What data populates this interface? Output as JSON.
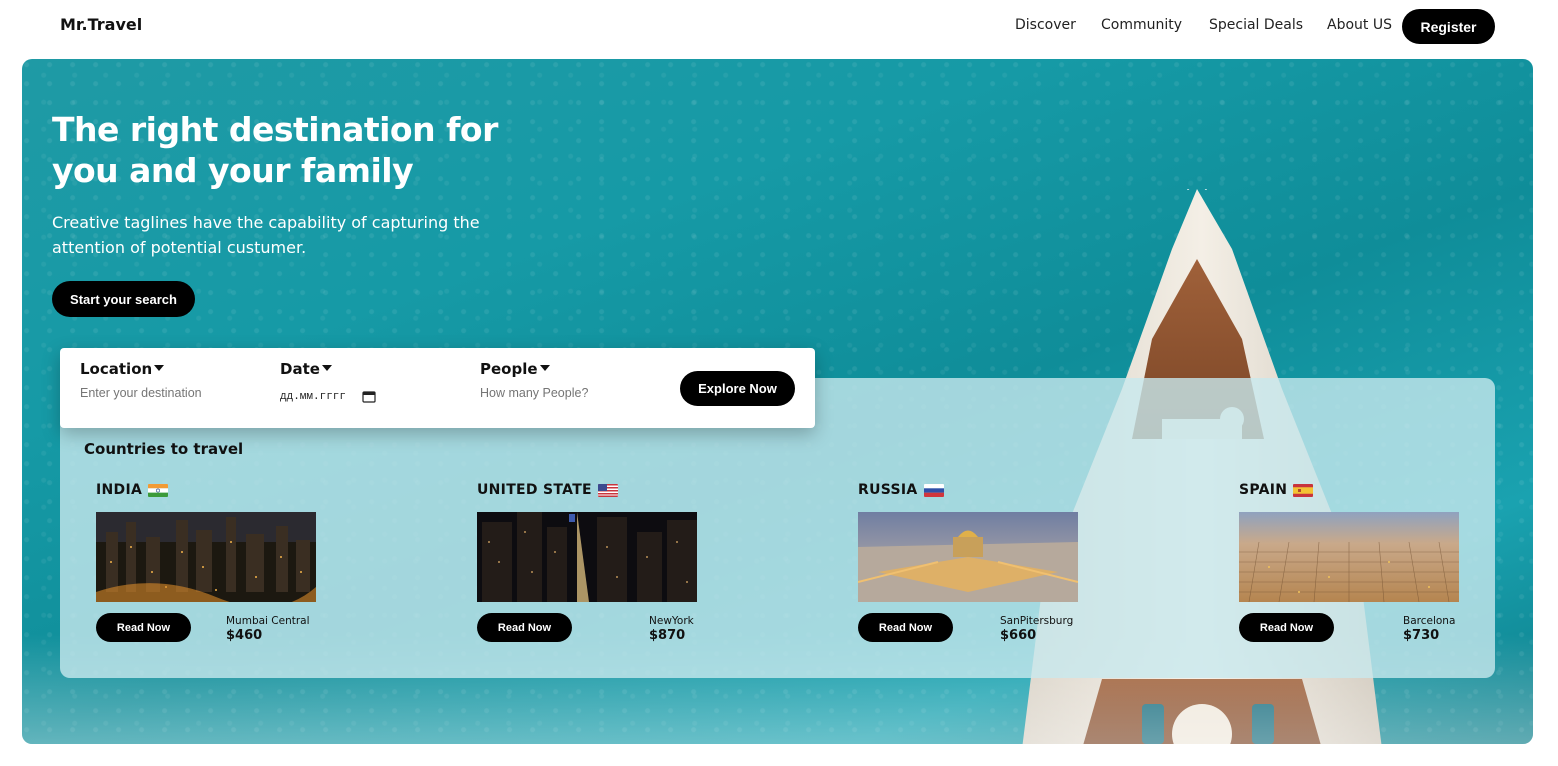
{
  "brand": "Mr.Travel",
  "nav": {
    "links": [
      "Discover",
      "Community",
      "Special Deals",
      "About US"
    ],
    "register_label": "Register"
  },
  "hero": {
    "title": "The right destination for you and your family",
    "subtitle": "Creative taglines have the capability of capturing the attention of potential custumer.",
    "cta_label": "Start your search"
  },
  "search": {
    "location_label": "Location",
    "location_placeholder": "Enter your destination",
    "date_label": "Date",
    "date_placeholder": "дд.мм.гггг",
    "people_label": "People",
    "people_placeholder": "How many People?",
    "explore_label": "Explore Now"
  },
  "countries": {
    "title": "Countries to travel",
    "read_label": "Read Now",
    "items": [
      {
        "name": "INDIA",
        "city": "Mumbai Central",
        "price": "$460",
        "flag": "india-flag-icon"
      },
      {
        "name": "UNITED STATE",
        "city": "NewYork",
        "price": "$870",
        "flag": "us-flag-icon"
      },
      {
        "name": "RUSSIA",
        "city": "SanPitersburg",
        "price": "$660",
        "flag": "russia-flag-icon"
      },
      {
        "name": "SPAIN",
        "city": "Barcelona",
        "price": "$730",
        "flag": "spain-flag-icon"
      }
    ]
  },
  "colors": {
    "accent": "#000000",
    "sea": "#169aa6",
    "panel": "#c8e8ee"
  }
}
